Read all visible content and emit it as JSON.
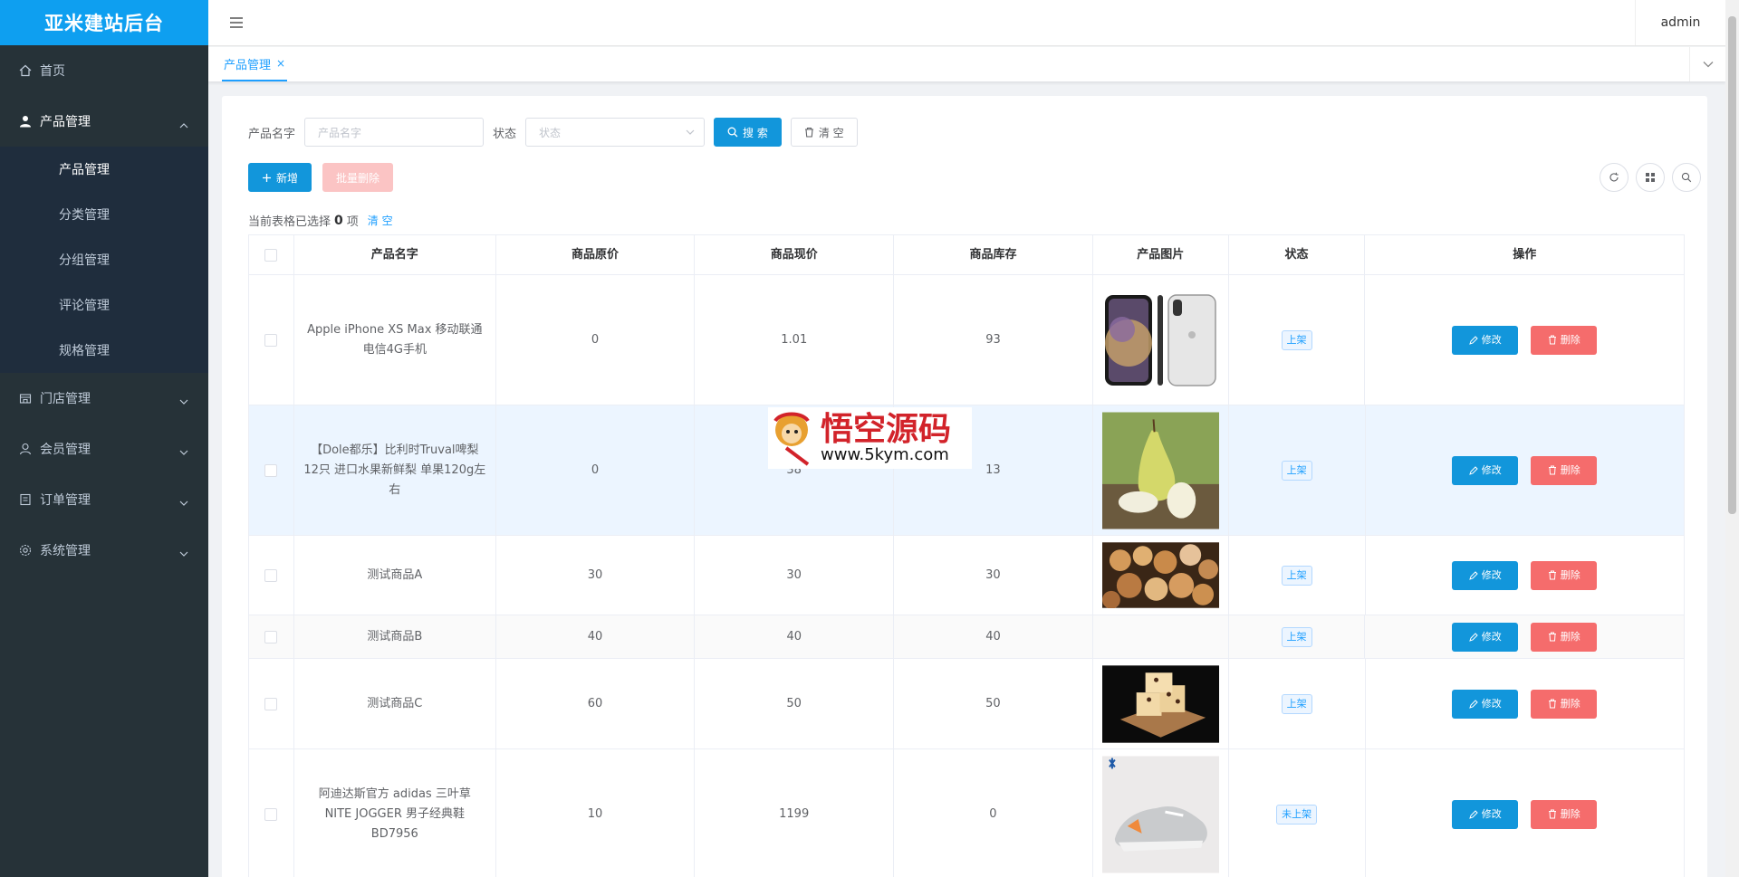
{
  "app": {
    "title": "亚米建站后台",
    "user": "admin"
  },
  "sidebar": {
    "home": "首页",
    "product_group": "产品管理",
    "product_subs": [
      "产品管理",
      "分类管理",
      "分组管理",
      "评论管理",
      "规格管理"
    ],
    "store": "门店管理",
    "member": "会员管理",
    "order": "订单管理",
    "system": "系统管理"
  },
  "tabs": [
    {
      "label": "产品管理",
      "close": "×"
    }
  ],
  "search": {
    "name_label": "产品名字",
    "name_placeholder": "产品名字",
    "status_label": "状态",
    "status_placeholder": "状态",
    "search_btn": "搜 索",
    "clear_btn": "清 空"
  },
  "actions": {
    "add": "新增",
    "batch_delete": "批量删除"
  },
  "selection": {
    "prefix": "当前表格已选择",
    "count": "0",
    "suffix": "项",
    "clear": "清 空"
  },
  "table": {
    "columns": [
      "产品名字",
      "商品原价",
      "商品现价",
      "商品库存",
      "产品图片",
      "状态",
      "操作"
    ],
    "edit_label": "修改",
    "delete_label": "删除",
    "rows": [
      {
        "name": "Apple iPhone XS Max 移动联通电信4G手机",
        "orig": "0",
        "price": "1.01",
        "stock": "93",
        "img": "iphone",
        "status": "上架"
      },
      {
        "name": "【Dole都乐】比利时Truval啤梨12只 进口水果新鲜梨 单果120g左右",
        "orig": "0",
        "price": "38",
        "stock": "13",
        "img": "pear",
        "status": "上架"
      },
      {
        "name": "测试商品A",
        "orig": "30",
        "price": "30",
        "stock": "30",
        "img": "cookies",
        "status": "上架"
      },
      {
        "name": "测试商品B",
        "orig": "40",
        "price": "40",
        "stock": "40",
        "img": "",
        "status": "上架"
      },
      {
        "name": "测试商品C",
        "orig": "60",
        "price": "50",
        "stock": "50",
        "img": "cake",
        "status": "上架"
      },
      {
        "name": "阿迪达斯官方 adidas 三叶草 NITE JOGGER 男子经典鞋BD7956",
        "orig": "10",
        "price": "1199",
        "stock": "0",
        "img": "shoe",
        "status": "未上架"
      }
    ]
  },
  "watermark": {
    "line1": "悟空源码",
    "line2": "www.5kym.com"
  },
  "colors": {
    "sidebar_bg": "#263238",
    "submenu_bg": "#1f2d3d",
    "logo_bg": "#0e9ff0",
    "primary": "#1296db",
    "danger": "#f56c6c",
    "highlight_row": "#ecf5ff"
  }
}
